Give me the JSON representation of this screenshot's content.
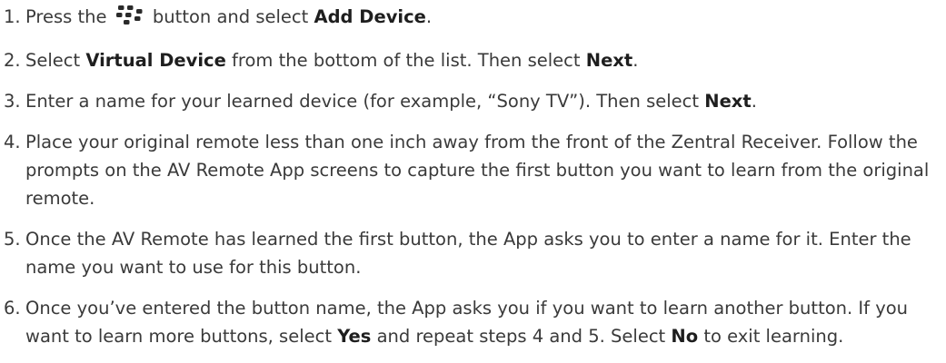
{
  "steps": [
    {
      "number": "1.",
      "parts": [
        {
          "text": "Press the "
        },
        {
          "icon": "blackberry-menu-icon"
        },
        {
          "text": " button and select "
        },
        {
          "text": "Add Device",
          "bold": true
        },
        {
          "text": "."
        }
      ]
    },
    {
      "number": "2.",
      "parts": [
        {
          "text": "Select "
        },
        {
          "text": "Virtual Device",
          "bold": true
        },
        {
          "text": " from the bottom of the list. Then select "
        },
        {
          "text": "Next",
          "bold": true
        },
        {
          "text": "."
        }
      ]
    },
    {
      "number": "3.",
      "parts": [
        {
          "text": "Enter a name for your learned device (for example, “Sony TV”). Then select "
        },
        {
          "text": "Next",
          "bold": true
        },
        {
          "text": "."
        }
      ]
    },
    {
      "number": "4.",
      "parts": [
        {
          "text": "Place your original remote less than one inch away from the front of the Zentral Receiver. Follow the prompts on the AV Remote App screens to capture the first button you want to learn from the original remote."
        }
      ]
    },
    {
      "number": "5.",
      "parts": [
        {
          "text": "Once the AV Remote has learned the first button, the App asks you to enter a name for it. Enter the name you want to use for this button."
        }
      ]
    },
    {
      "number": "6.",
      "parts": [
        {
          "text": "Once you’ve entered the button name, the App asks you if you want to learn another button. If you want to learn more buttons, select "
        },
        {
          "text": "Yes",
          "bold": true
        },
        {
          "text": " and repeat steps 4 and 5. Select "
        },
        {
          "text": "No",
          "bold": true
        },
        {
          "text": " to exit learning."
        }
      ]
    }
  ]
}
